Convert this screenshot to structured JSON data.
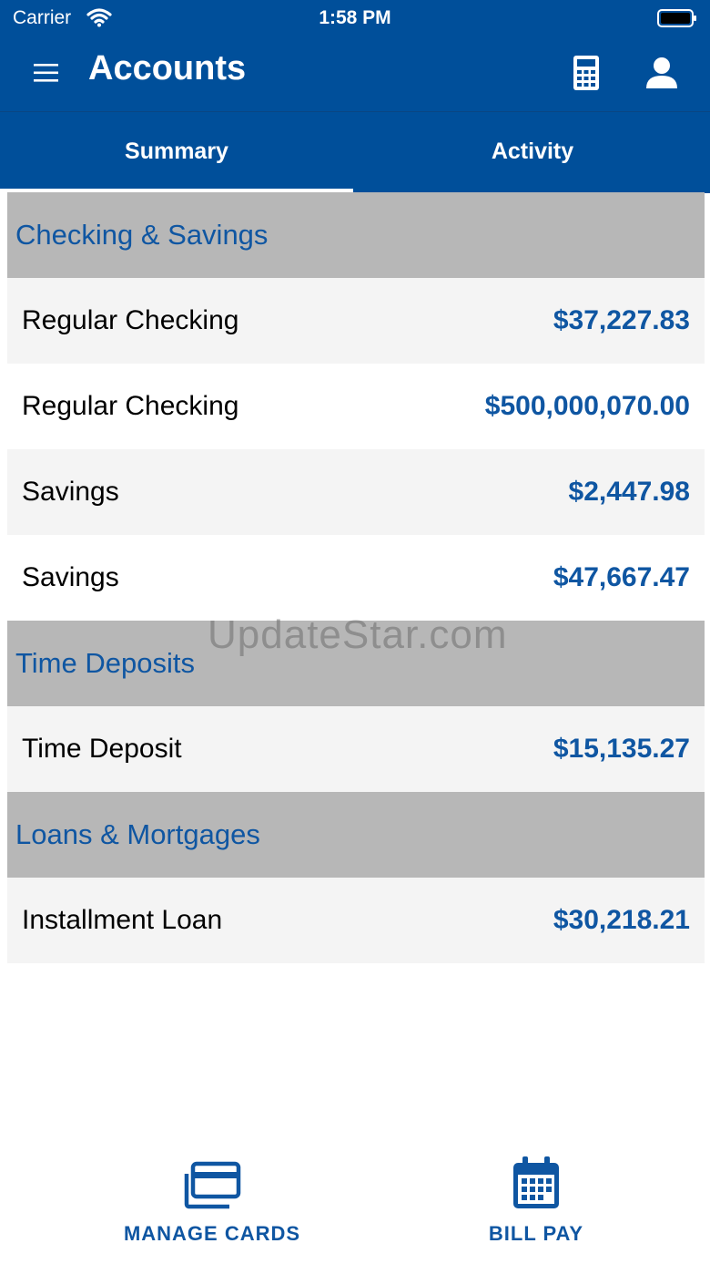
{
  "status_bar": {
    "carrier": "Carrier",
    "time": "1:58 PM"
  },
  "header": {
    "title": "Accounts"
  },
  "tabs": [
    {
      "label": "Summary",
      "selected": true
    },
    {
      "label": "Activity",
      "selected": false
    }
  ],
  "sections": [
    {
      "title": "Checking & Savings",
      "accounts": [
        {
          "name": "Regular Checking",
          "balance": "$37,227.83"
        },
        {
          "name": "Regular Checking",
          "balance": "$500,000,070.00"
        },
        {
          "name": "Savings",
          "balance": "$2,447.98"
        },
        {
          "name": "Savings",
          "balance": "$47,667.47"
        }
      ]
    },
    {
      "title": "Time Deposits",
      "accounts": [
        {
          "name": "Time Deposit",
          "balance": "$15,135.27"
        }
      ]
    },
    {
      "title": "Loans & Mortgages",
      "accounts": [
        {
          "name": "Installment Loan",
          "balance": "$30,218.21"
        }
      ]
    }
  ],
  "watermark": "UpdateStar.com",
  "bottom_nav": {
    "manage_cards": "MANAGE CARDS",
    "bill_pay": "BILL PAY"
  },
  "colors": {
    "primary": "#004f9a",
    "accent_text": "#0f56a2",
    "section_bg": "#b7b7b7",
    "row_alt": "#f4f4f4"
  },
  "icons": {
    "menu": "hamburger-menu-icon",
    "calculator": "calculator-icon",
    "user": "user-icon",
    "cards": "credit-cards-icon",
    "bill_pay": "calendar-icon"
  }
}
